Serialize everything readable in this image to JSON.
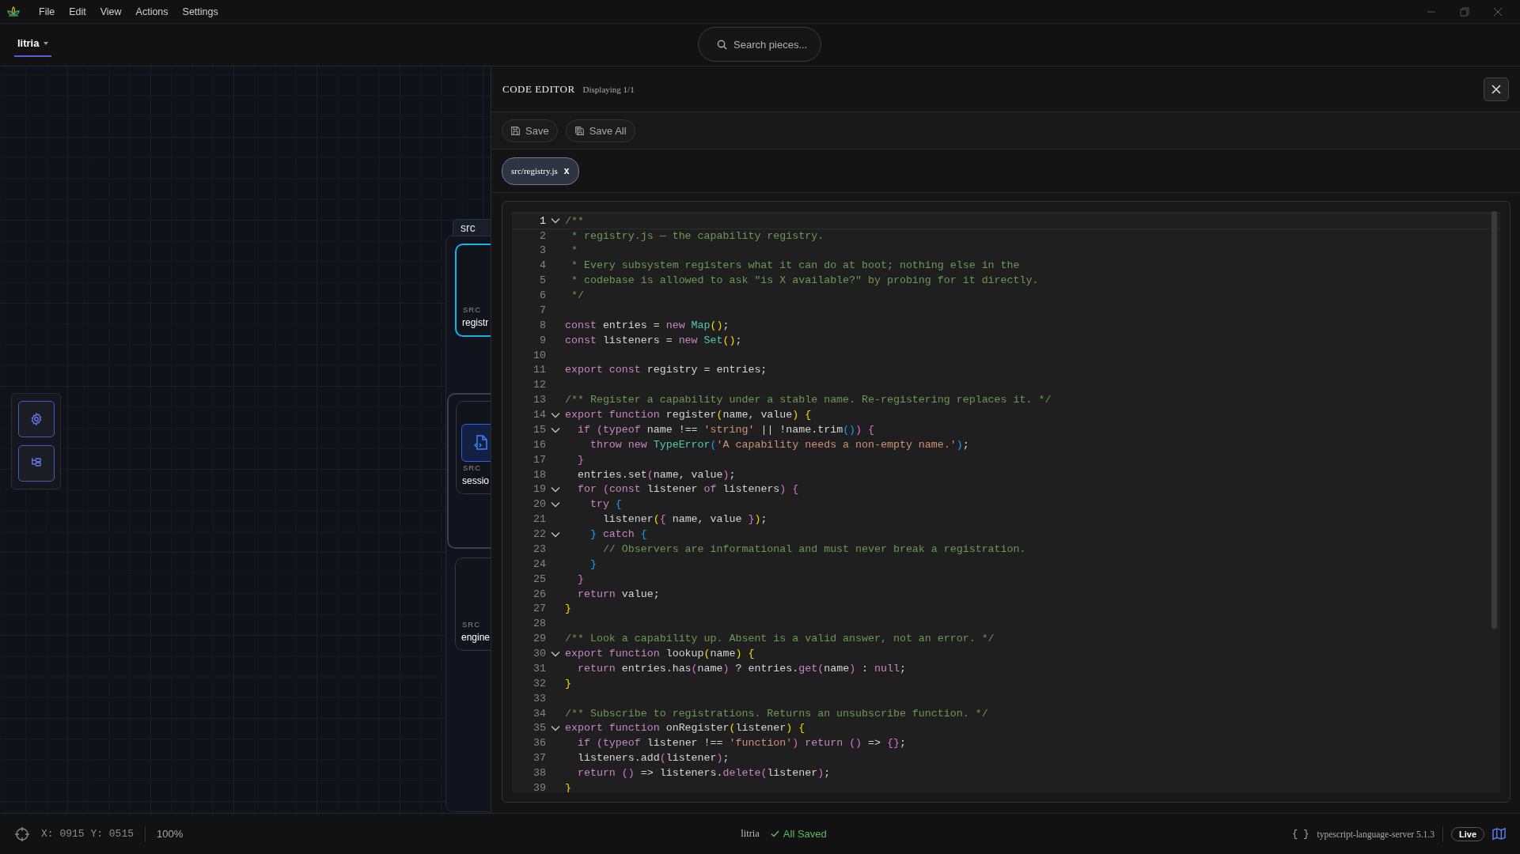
{
  "menu": [
    "File",
    "Edit",
    "View",
    "Actions",
    "Settings"
  ],
  "project_tab": {
    "label": "litria",
    "selected": true
  },
  "search": {
    "placeholder": "Search pieces..."
  },
  "canvas": {
    "tools": [
      {
        "kind": "settings"
      },
      {
        "kind": "tree"
      }
    ],
    "group": {
      "label": "src",
      "nodes": [
        {
          "kind": "plain",
          "folder": "SRC",
          "name": "registr",
          "selected": true
        },
        {
          "kind": "file",
          "folder": "SRC",
          "name": "sessio",
          "selected": false
        },
        {
          "kind": "plain",
          "folder": "SRC",
          "name": "engine",
          "selected": false
        }
      ]
    }
  },
  "editor": {
    "title": "CODE EDITOR",
    "subtitle": "Displaying 1/1",
    "actions": [
      {
        "kind": "save",
        "label": "Save"
      },
      {
        "kind": "save-all",
        "label": "Save All"
      }
    ],
    "tabs": [
      {
        "label": "src/registry.js",
        "close": "x",
        "selected": true
      }
    ],
    "lines": [
      {
        "number": "1",
        "fold": true,
        "active": true,
        "tokens": [
          {
            "kind": "c",
            "text": "/**"
          }
        ]
      },
      {
        "number": "2",
        "fold": false,
        "active": false,
        "tokens": [
          {
            "kind": "c",
            "text": " * registry.js — the capability registry."
          }
        ]
      },
      {
        "number": "3",
        "fold": false,
        "active": false,
        "tokens": [
          {
            "kind": "c",
            "text": " *"
          }
        ]
      },
      {
        "number": "4",
        "fold": false,
        "active": false,
        "tokens": [
          {
            "kind": "c",
            "text": " * Every subsystem registers what it can do at boot; nothing else in the"
          }
        ]
      },
      {
        "number": "5",
        "fold": false,
        "active": false,
        "tokens": [
          {
            "kind": "c",
            "text": " * codebase is allowed to ask \"is X available?\" by probing for it directly."
          }
        ]
      },
      {
        "number": "6",
        "fold": false,
        "active": false,
        "tokens": [
          {
            "kind": "c",
            "text": " */"
          }
        ]
      },
      {
        "number": "7",
        "fold": false,
        "active": false
      },
      {
        "number": "8",
        "fold": false,
        "active": false,
        "tokens": [
          {
            "kind": "k",
            "text": "const"
          },
          {
            "kind": "p",
            "text": " entries = "
          },
          {
            "kind": "k",
            "text": "new "
          },
          {
            "kind": "t",
            "text": "Map"
          },
          {
            "kind": "y",
            "text": "()"
          },
          {
            "kind": "p",
            "text": ";"
          }
        ]
      },
      {
        "number": "9",
        "fold": false,
        "active": false,
        "tokens": [
          {
            "kind": "k",
            "text": "const"
          },
          {
            "kind": "p",
            "text": " listeners = "
          },
          {
            "kind": "k",
            "text": "new "
          },
          {
            "kind": "t",
            "text": "Set"
          },
          {
            "kind": "y",
            "text": "()"
          },
          {
            "kind": "p",
            "text": ";"
          }
        ]
      },
      {
        "number": "10",
        "fold": false,
        "active": false
      },
      {
        "number": "11",
        "fold": false,
        "active": false,
        "tokens": [
          {
            "kind": "k",
            "text": "export const"
          },
          {
            "kind": "p",
            "text": " registry = entries;"
          }
        ]
      },
      {
        "number": "12",
        "fold": false,
        "active": false
      },
      {
        "number": "13",
        "fold": false,
        "active": false,
        "tokens": [
          {
            "kind": "c",
            "text": "/** Register a capability under a stable name. Re-registering replaces it. */"
          }
        ]
      },
      {
        "number": "14",
        "fold": true,
        "active": false,
        "tokens": [
          {
            "kind": "k",
            "text": "export function"
          },
          {
            "kind": "p",
            "text": " register"
          },
          {
            "kind": "y",
            "text": "("
          },
          {
            "kind": "p",
            "text": "name, value"
          },
          {
            "kind": "y",
            "text": ")"
          },
          {
            "kind": "y",
            "text": " {"
          }
        ]
      },
      {
        "number": "15",
        "fold": true,
        "active": false,
        "tokens": [
          {
            "kind": "k",
            "text": "  if "
          },
          {
            "kind": "m",
            "text": "("
          },
          {
            "kind": "k",
            "text": "typeof"
          },
          {
            "kind": "p",
            "text": " name !== "
          },
          {
            "kind": "s",
            "text": "'string'"
          },
          {
            "kind": "p",
            "text": " || !name.trim"
          },
          {
            "kind": "b",
            "text": "()"
          },
          {
            "kind": "m",
            "text": ")"
          },
          {
            "kind": "m",
            "text": " {"
          }
        ]
      },
      {
        "number": "16",
        "fold": false,
        "active": false,
        "tokens": [
          {
            "kind": "k",
            "text": "    throw new "
          },
          {
            "kind": "t",
            "text": "TypeError"
          },
          {
            "kind": "b",
            "text": "("
          },
          {
            "kind": "s",
            "text": "'A capability needs a non-empty name.'"
          },
          {
            "kind": "b",
            "text": ")"
          },
          {
            "kind": "p",
            "text": ";"
          }
        ]
      },
      {
        "number": "17",
        "fold": false,
        "active": false,
        "tokens": [
          {
            "kind": "m",
            "text": "  }"
          }
        ]
      },
      {
        "number": "18",
        "fold": false,
        "active": false,
        "tokens": [
          {
            "kind": "p",
            "text": "  entries.set"
          },
          {
            "kind": "m",
            "text": "("
          },
          {
            "kind": "p",
            "text": "name, value"
          },
          {
            "kind": "m",
            "text": ")"
          },
          {
            "kind": "p",
            "text": ";"
          }
        ]
      },
      {
        "number": "19",
        "fold": true,
        "active": false,
        "tokens": [
          {
            "kind": "k",
            "text": "  for "
          },
          {
            "kind": "m",
            "text": "("
          },
          {
            "kind": "k",
            "text": "const"
          },
          {
            "kind": "p",
            "text": " listener "
          },
          {
            "kind": "k",
            "text": "of"
          },
          {
            "kind": "p",
            "text": " listeners"
          },
          {
            "kind": "m",
            "text": ")"
          },
          {
            "kind": "m",
            "text": " {"
          }
        ]
      },
      {
        "number": "20",
        "fold": true,
        "active": false,
        "tokens": [
          {
            "kind": "k",
            "text": "    try "
          },
          {
            "kind": "b",
            "text": "{"
          }
        ]
      },
      {
        "number": "21",
        "fold": false,
        "active": false,
        "tokens": [
          {
            "kind": "p",
            "text": "      listener"
          },
          {
            "kind": "y",
            "text": "("
          },
          {
            "kind": "m",
            "text": "{"
          },
          {
            "kind": "p",
            "text": " name, value "
          },
          {
            "kind": "m",
            "text": "}"
          },
          {
            "kind": "y",
            "text": ")"
          },
          {
            "kind": "p",
            "text": ";"
          }
        ]
      },
      {
        "number": "22",
        "fold": true,
        "active": false,
        "tokens": [
          {
            "kind": "b",
            "text": "    }"
          },
          {
            "kind": "k",
            "text": " catch "
          },
          {
            "kind": "b",
            "text": "{"
          }
        ]
      },
      {
        "number": "23",
        "fold": false,
        "active": false,
        "tokens": [
          {
            "kind": "c",
            "text": "      // Observers are informational and must never break a registration."
          }
        ]
      },
      {
        "number": "24",
        "fold": false,
        "active": false,
        "tokens": [
          {
            "kind": "b",
            "text": "    }"
          }
        ]
      },
      {
        "number": "25",
        "fold": false,
        "active": false,
        "tokens": [
          {
            "kind": "m",
            "text": "  }"
          }
        ]
      },
      {
        "number": "26",
        "fold": false,
        "active": false,
        "tokens": [
          {
            "kind": "k",
            "text": "  return"
          },
          {
            "kind": "p",
            "text": " value;"
          }
        ]
      },
      {
        "number": "27",
        "fold": false,
        "active": false,
        "tokens": [
          {
            "kind": "y",
            "text": "}"
          }
        ]
      },
      {
        "number": "28",
        "fold": false,
        "active": false
      },
      {
        "number": "29",
        "fold": false,
        "active": false,
        "tokens": [
          {
            "kind": "c",
            "text": "/** Look a capability up. Absent is a valid answer, not an error. */"
          }
        ]
      },
      {
        "number": "30",
        "fold": true,
        "active": false,
        "tokens": [
          {
            "kind": "k",
            "text": "export function"
          },
          {
            "kind": "p",
            "text": " lookup"
          },
          {
            "kind": "y",
            "text": "("
          },
          {
            "kind": "p",
            "text": "name"
          },
          {
            "kind": "y",
            "text": ")"
          },
          {
            "kind": "y",
            "text": " {"
          }
        ]
      },
      {
        "number": "31",
        "fold": false,
        "active": false,
        "tokens": [
          {
            "kind": "k",
            "text": "  return"
          },
          {
            "kind": "p",
            "text": " entries.has"
          },
          {
            "kind": "m",
            "text": "("
          },
          {
            "kind": "p",
            "text": "name"
          },
          {
            "kind": "m",
            "text": ")"
          },
          {
            "kind": "p",
            "text": " ? entries."
          },
          {
            "kind": "k",
            "text": "get"
          },
          {
            "kind": "m",
            "text": "("
          },
          {
            "kind": "p",
            "text": "name"
          },
          {
            "kind": "m",
            "text": ")"
          },
          {
            "kind": "p",
            "text": " : "
          },
          {
            "kind": "k",
            "text": "null"
          },
          {
            "kind": "p",
            "text": ";"
          }
        ]
      },
      {
        "number": "32",
        "fold": false,
        "active": false,
        "tokens": [
          {
            "kind": "y",
            "text": "}"
          }
        ]
      },
      {
        "number": "33",
        "fold": false,
        "active": false
      },
      {
        "number": "34",
        "fold": false,
        "active": false,
        "tokens": [
          {
            "kind": "c",
            "text": "/** Subscribe to registrations. Returns an unsubscribe function. */"
          }
        ]
      },
      {
        "number": "35",
        "fold": true,
        "active": false,
        "tokens": [
          {
            "kind": "k",
            "text": "export function"
          },
          {
            "kind": "p",
            "text": " onRegister"
          },
          {
            "kind": "y",
            "text": "("
          },
          {
            "kind": "p",
            "text": "listener"
          },
          {
            "kind": "y",
            "text": ")"
          },
          {
            "kind": "y",
            "text": " {"
          }
        ]
      },
      {
        "number": "36",
        "fold": false,
        "active": false,
        "tokens": [
          {
            "kind": "k",
            "text": "  if "
          },
          {
            "kind": "m",
            "text": "("
          },
          {
            "kind": "k",
            "text": "typeof"
          },
          {
            "kind": "p",
            "text": " listener !== "
          },
          {
            "kind": "s",
            "text": "'function'"
          },
          {
            "kind": "m",
            "text": ")"
          },
          {
            "kind": "k",
            "text": " return "
          },
          {
            "kind": "m",
            "text": "()"
          },
          {
            "kind": "p",
            "text": " => "
          },
          {
            "kind": "m",
            "text": "{}"
          },
          {
            "kind": "p",
            "text": ";"
          }
        ]
      },
      {
        "number": "37",
        "fold": false,
        "active": false,
        "tokens": [
          {
            "kind": "p",
            "text": "  listeners.add"
          },
          {
            "kind": "m",
            "text": "("
          },
          {
            "kind": "p",
            "text": "listener"
          },
          {
            "kind": "m",
            "text": ")"
          },
          {
            "kind": "p",
            "text": ";"
          }
        ]
      },
      {
        "number": "38",
        "fold": false,
        "active": false,
        "tokens": [
          {
            "kind": "k",
            "text": "  return "
          },
          {
            "kind": "m",
            "text": "()"
          },
          {
            "kind": "p",
            "text": " => listeners."
          },
          {
            "kind": "k",
            "text": "delete"
          },
          {
            "kind": "m",
            "text": "("
          },
          {
            "kind": "p",
            "text": "listener"
          },
          {
            "kind": "m",
            "text": ")"
          },
          {
            "kind": "p",
            "text": ";"
          }
        ]
      },
      {
        "number": "39",
        "fold": false,
        "active": false,
        "tokens": [
          {
            "kind": "y",
            "text": "}"
          }
        ]
      }
    ]
  },
  "status_bar": {
    "cursor": "X: 0915 Y: 0515",
    "zoom": "100%",
    "project": "litria",
    "save_state": "All Saved",
    "language_server": {
      "icon": "{ }",
      "label": "typescript-language-server 5.1.3"
    },
    "mode": "Live"
  }
}
